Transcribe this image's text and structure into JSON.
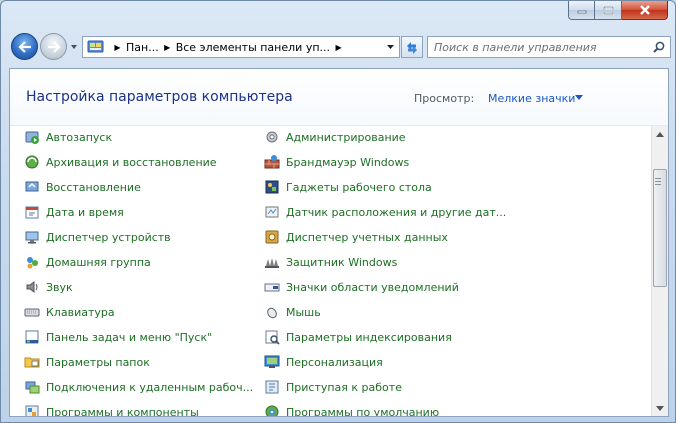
{
  "address": {
    "crumbs": [
      "Пан...",
      "Все элементы панели уп..."
    ]
  },
  "search": {
    "placeholder": "Поиск в панели управления"
  },
  "header": {
    "title": "Настройка параметров компьютера",
    "view_by_label": "Просмотр:",
    "view_by_value": "Мелкие значки"
  },
  "items_left": [
    {
      "label": "Автозапуск",
      "icon": "autoplay-icon"
    },
    {
      "label": "Архивация и восстановление",
      "icon": "backup-icon"
    },
    {
      "label": "Восстановление",
      "icon": "recovery-icon"
    },
    {
      "label": "Дата и время",
      "icon": "date-time-icon"
    },
    {
      "label": "Диспетчер устройств",
      "icon": "device-manager-icon"
    },
    {
      "label": "Домашняя группа",
      "icon": "homegroup-icon"
    },
    {
      "label": "Звук",
      "icon": "sound-icon"
    },
    {
      "label": "Клавиатура",
      "icon": "keyboard-icon"
    },
    {
      "label": "Панель задач и меню \"Пуск\"",
      "icon": "taskbar-icon"
    },
    {
      "label": "Параметры папок",
      "icon": "folder-options-icon"
    },
    {
      "label": "Подключения к удаленным рабоч...",
      "icon": "remote-connections-icon"
    },
    {
      "label": "Программы и компоненты",
      "icon": "programs-icon"
    }
  ],
  "items_right": [
    {
      "label": "Администрирование",
      "icon": "admin-tools-icon"
    },
    {
      "label": "Брандмауэр Windows",
      "icon": "firewall-icon"
    },
    {
      "label": "Гаджеты рабочего стола",
      "icon": "gadgets-icon"
    },
    {
      "label": "Датчик расположения и другие дат...",
      "icon": "location-sensor-icon"
    },
    {
      "label": "Диспетчер учетных данных",
      "icon": "credential-manager-icon"
    },
    {
      "label": "Защитник Windows",
      "icon": "defender-icon"
    },
    {
      "label": "Значки области уведомлений",
      "icon": "notification-icons-icon"
    },
    {
      "label": "Мышь",
      "icon": "mouse-icon"
    },
    {
      "label": "Параметры индексирования",
      "icon": "indexing-icon"
    },
    {
      "label": "Персонализация",
      "icon": "personalization-icon"
    },
    {
      "label": "Приступая к работе",
      "icon": "getting-started-icon"
    },
    {
      "label": "Программы по умолчанию",
      "icon": "default-programs-icon"
    }
  ],
  "colors": {
    "link": "#1d6e24",
    "title": "#1e3287",
    "view_link": "#1a57c4"
  }
}
